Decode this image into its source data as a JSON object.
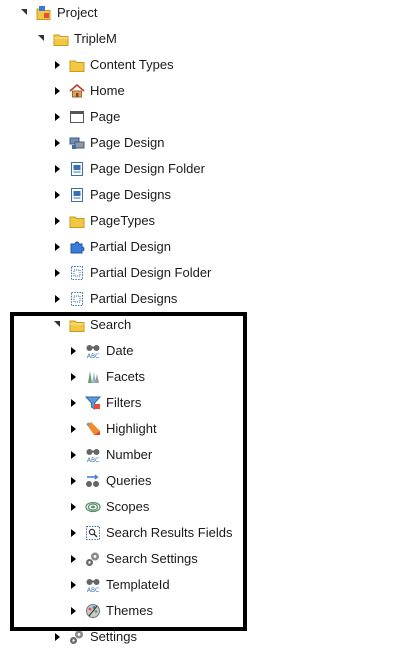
{
  "tree": {
    "project": {
      "label": "Project"
    },
    "triplem": {
      "label": "TripleM"
    },
    "children": [
      {
        "label": "Content Types"
      },
      {
        "label": "Home"
      },
      {
        "label": "Page"
      },
      {
        "label": "Page Design"
      },
      {
        "label": "Page Design Folder"
      },
      {
        "label": "Page Designs"
      },
      {
        "label": "PageTypes"
      },
      {
        "label": "Partial Design"
      },
      {
        "label": "Partial Design Folder"
      },
      {
        "label": "Partial Designs"
      }
    ],
    "search": {
      "label": "Search",
      "children": [
        {
          "label": "Date"
        },
        {
          "label": "Facets"
        },
        {
          "label": "Filters"
        },
        {
          "label": "Highlight"
        },
        {
          "label": "Number"
        },
        {
          "label": "Queries"
        },
        {
          "label": "Scopes"
        },
        {
          "label": "Search Results Fields"
        },
        {
          "label": "Search Settings"
        },
        {
          "label": "TemplateId"
        },
        {
          "label": "Themes"
        }
      ]
    },
    "settings": {
      "label": "Settings"
    }
  },
  "colors": {
    "highlight_border": "#000000",
    "folder": "#f2c744"
  },
  "icons": [
    "project-icon",
    "folder-icon",
    "home-icon",
    "page-icon",
    "page-design-icon",
    "page-design-folder-icon",
    "puzzle-icon",
    "dotted-page-icon",
    "abc-binoculars-icon",
    "facets-icon",
    "filter-icon",
    "highlight-icon",
    "queries-icon",
    "scopes-icon",
    "search-results-fields-icon",
    "gear-icon",
    "themes-icon"
  ]
}
